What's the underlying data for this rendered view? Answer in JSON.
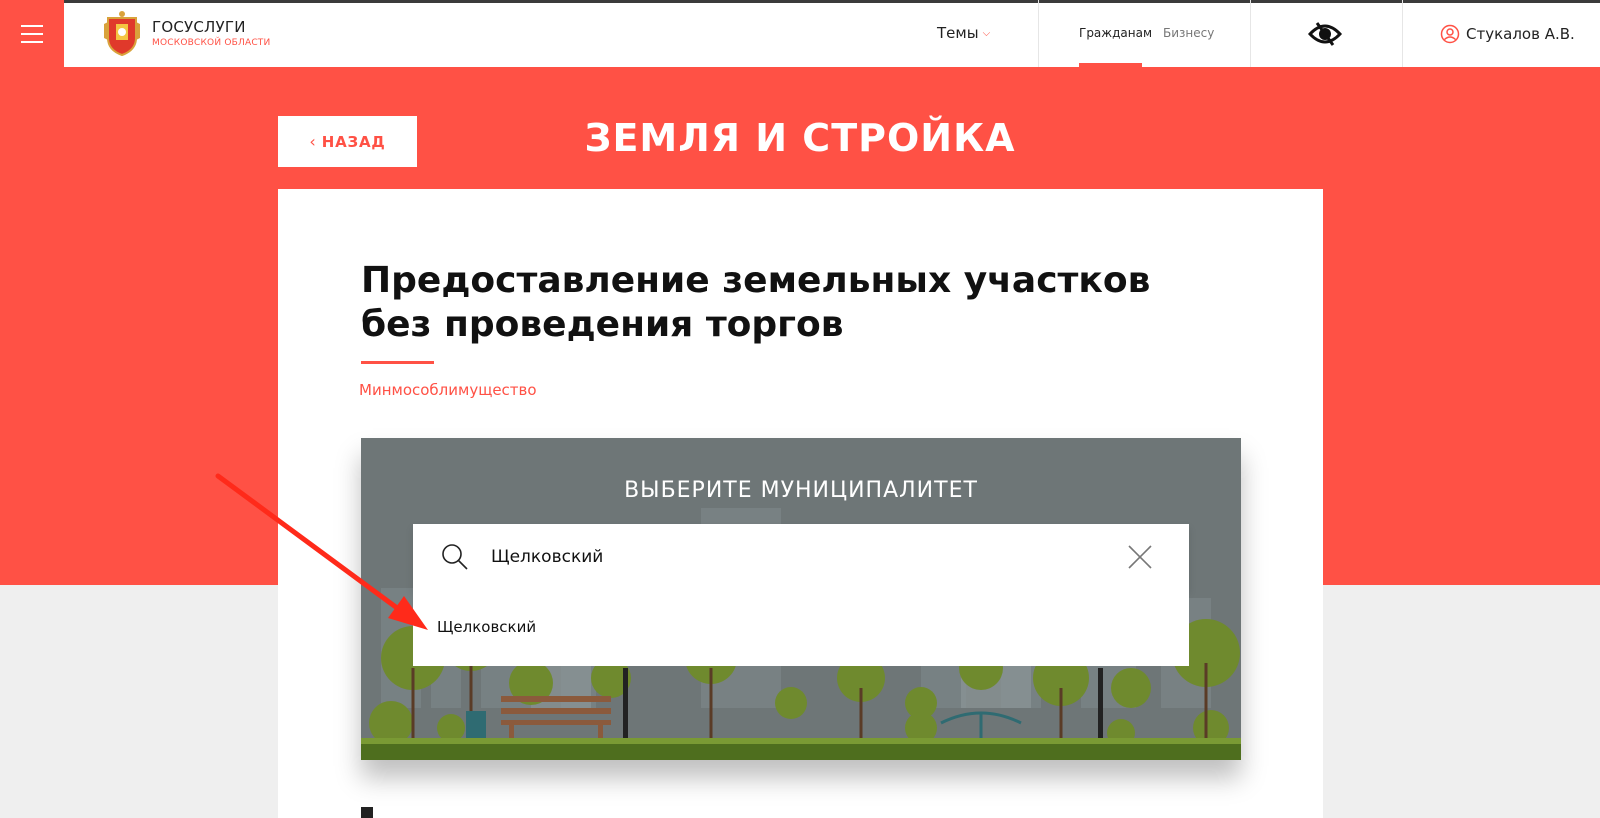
{
  "header": {
    "logo_title": "ГОСУСЛУГИ",
    "logo_subtitle": "МОСКОВСКОЙ ОБЛАСТИ",
    "themes_label": "Темы",
    "tab_citizens": "Гражданам",
    "tab_business": "Бизнесу",
    "user_name": "Стукалов А.В."
  },
  "hero": {
    "back_label": "НАЗАД",
    "section_title": "ЗЕМЛЯ И СТРОЙКА"
  },
  "service": {
    "title": "Предоставление земельных участков без проведения торгов",
    "agency": "Минмособлимущество"
  },
  "municipality": {
    "heading": "ВЫБЕРИТЕ МУНИЦИПАЛИТЕТ",
    "search_value": "Щелковский",
    "options": [
      "Щелковский"
    ]
  },
  "colors": {
    "brand": "#ff5145",
    "text": "#111111"
  },
  "icons": {
    "menu": "hamburger-icon",
    "coat_of_arms": "coat-of-arms-icon",
    "eye": "low-vision-eye-icon",
    "user": "user-icon",
    "search": "search-icon",
    "clear": "close-icon"
  }
}
